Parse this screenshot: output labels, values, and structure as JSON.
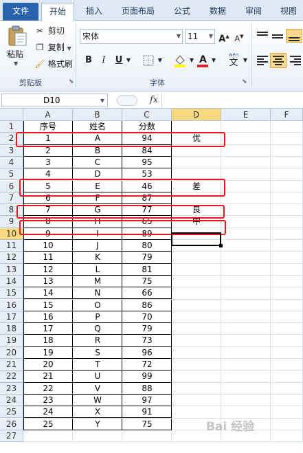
{
  "ribbon_tabs": [
    {
      "label": "文件"
    },
    {
      "label": "开始"
    },
    {
      "label": "插入"
    },
    {
      "label": "页面布局"
    },
    {
      "label": "公式"
    },
    {
      "label": "数据"
    },
    {
      "label": "审阅"
    },
    {
      "label": "视图"
    }
  ],
  "clipboard": {
    "paste_label": "粘贴",
    "cut_label": "剪切",
    "copy_label": "复制",
    "format_painter_label": "格式刷",
    "group_label": "剪贴板"
  },
  "font": {
    "font_name": "宋体",
    "font_size": "11",
    "grow_label": "A",
    "shrink_label": "A",
    "bold_label": "B",
    "italic_label": "I",
    "underline_label": "U",
    "phonetic_label": "wén",
    "phonetic_char": "文",
    "group_label": "字体"
  },
  "formula_bar": {
    "name_box": "D10",
    "fx_label": "fx",
    "formula": ""
  },
  "sheet": {
    "columns": [
      "A",
      "B",
      "C",
      "D",
      "E",
      "F"
    ],
    "selected_column": "D",
    "selected_row": "10",
    "row_numbers": [
      "1",
      "2",
      "3",
      "4",
      "5",
      "6",
      "7",
      "8",
      "9",
      "10",
      "11",
      "12",
      "13",
      "14",
      "15",
      "16",
      "17",
      "18",
      "19",
      "20",
      "21",
      "22",
      "23",
      "24",
      "25",
      "26",
      "27"
    ],
    "headers": [
      "序号",
      "姓名",
      "分数"
    ],
    "rows": [
      [
        "1",
        "A",
        "94",
        "优"
      ],
      [
        "2",
        "B",
        "84",
        ""
      ],
      [
        "3",
        "C",
        "95",
        ""
      ],
      [
        "4",
        "D",
        "53",
        ""
      ],
      [
        "5",
        "E",
        "46",
        "差"
      ],
      [
        "6",
        "F",
        "87",
        ""
      ],
      [
        "7",
        "G",
        "77",
        "良"
      ],
      [
        "8",
        "H",
        "65",
        "中"
      ],
      [
        "9",
        "I",
        "89",
        ""
      ],
      [
        "10",
        "J",
        "80",
        ""
      ],
      [
        "11",
        "K",
        "79",
        ""
      ],
      [
        "12",
        "L",
        "81",
        ""
      ],
      [
        "13",
        "M",
        "75",
        ""
      ],
      [
        "14",
        "N",
        "66",
        ""
      ],
      [
        "15",
        "O",
        "86",
        ""
      ],
      [
        "16",
        "P",
        "70",
        ""
      ],
      [
        "17",
        "Q",
        "79",
        ""
      ],
      [
        "18",
        "R",
        "73",
        ""
      ],
      [
        "19",
        "S",
        "96",
        ""
      ],
      [
        "20",
        "T",
        "72",
        ""
      ],
      [
        "21",
        "U",
        "99",
        ""
      ],
      [
        "22",
        "V",
        "88",
        ""
      ],
      [
        "23",
        "W",
        "97",
        ""
      ],
      [
        "24",
        "X",
        "91",
        ""
      ],
      [
        "25",
        "Y",
        "75",
        ""
      ]
    ]
  },
  "watermark_text": "Bai 经验",
  "colors": {
    "file_tab": "#2a63ad",
    "selected_header": "#f9d97f",
    "annotation_red": "#e81818"
  }
}
